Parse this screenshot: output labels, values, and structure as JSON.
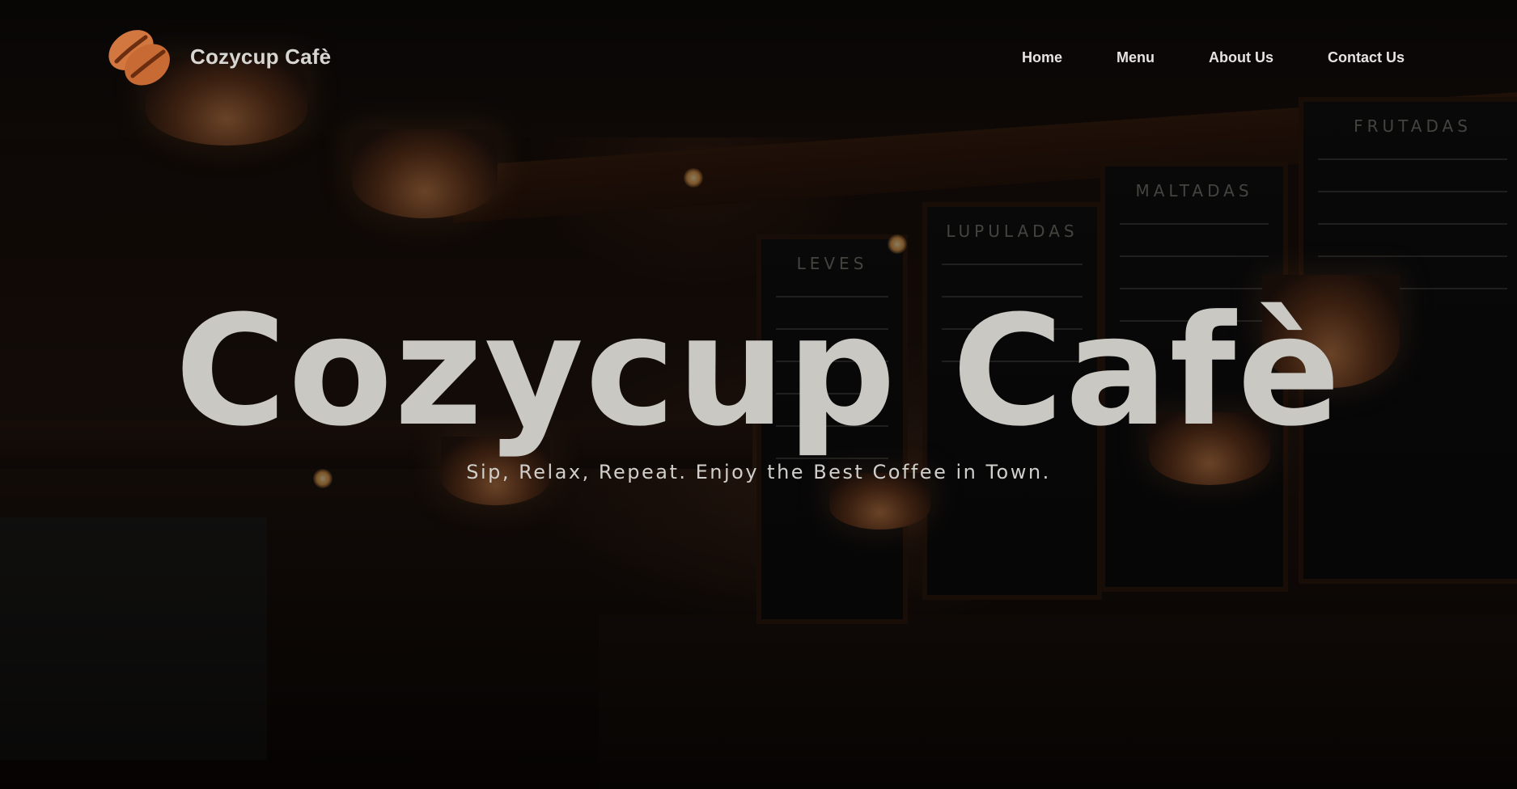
{
  "brand": {
    "name": "Cozycup Cafè",
    "logo_icon": "coffee-beans-icon"
  },
  "nav": {
    "items": [
      {
        "label": "Home"
      },
      {
        "label": "Menu"
      },
      {
        "label": "About Us"
      },
      {
        "label": "Contact Us"
      }
    ]
  },
  "hero": {
    "title": "Cozycup Cafè",
    "subtitle": "Sip, Relax, Repeat. Enjoy the Best Coffee in Town.",
    "background": "cafe-bar-interior-photo"
  },
  "menu_boards": [
    {
      "title": "LEVES"
    },
    {
      "title": "LUPULADAS"
    },
    {
      "title": "MALTADAS"
    },
    {
      "title": "FRUTADAS"
    }
  ],
  "colors": {
    "logo_bean": "#d2773f",
    "text_light": "#d8d6d2",
    "hero_title": "#c9c8c3"
  }
}
